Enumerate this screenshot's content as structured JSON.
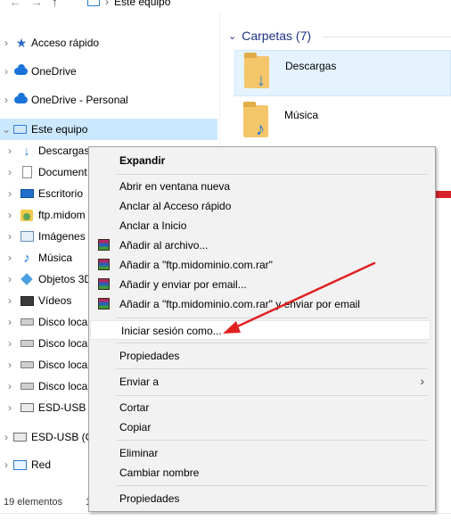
{
  "address": {
    "path": "Este equipo"
  },
  "nav": {
    "back": "←",
    "forward": "→",
    "up": "↑"
  },
  "sidebar": {
    "items": [
      {
        "label": "Acceso rápido"
      },
      {
        "label": "OneDrive"
      },
      {
        "label": "OneDrive - Personal"
      },
      {
        "label": "Este equipo"
      },
      {
        "label": "Descargas"
      },
      {
        "label": "Document"
      },
      {
        "label": "Escritorio"
      },
      {
        "label": "ftp.midom"
      },
      {
        "label": "Imágenes"
      },
      {
        "label": "Música"
      },
      {
        "label": "Objetos 3D"
      },
      {
        "label": "Vídeos"
      },
      {
        "label": "Disco local"
      },
      {
        "label": "Disco local"
      },
      {
        "label": "Disco local"
      },
      {
        "label": "Disco local"
      },
      {
        "label": "ESD-USB ("
      },
      {
        "label": "ESD-USB (G:"
      },
      {
        "label": "Red"
      }
    ],
    "selected_index": 3
  },
  "status": {
    "count": "19 elementos",
    "selection": "1"
  },
  "main": {
    "group_title": "Carpetas (7)",
    "tiles": [
      {
        "label": "Descargas"
      },
      {
        "label": "Música"
      }
    ]
  },
  "context_menu": {
    "items": [
      {
        "label": "Expandir"
      },
      {
        "label": "Abrir en ventana nueva"
      },
      {
        "label": "Anclar al Acceso rápido"
      },
      {
        "label": "Anclar a Inicio"
      },
      {
        "label": "Añadir al archivo..."
      },
      {
        "label": "Añadir a \"ftp.midominio.com.rar\""
      },
      {
        "label": "Añadir y enviar por email..."
      },
      {
        "label": "Añadir a \"ftp.midominio.com.rar\" y enviar por email"
      },
      {
        "label": "Iniciar sesión como..."
      },
      {
        "label": "Propiedades"
      },
      {
        "label": "Enviar a"
      },
      {
        "label": "Cortar"
      },
      {
        "label": "Copiar"
      },
      {
        "label": "Eliminar"
      },
      {
        "label": "Cambiar nombre"
      },
      {
        "label": "Propiedades"
      }
    ],
    "highlighted_index": 8
  },
  "colors": {
    "selection": "#cce8ff",
    "group_header": "#1e3287",
    "annotation_arrow": "#e02020",
    "menu_background": "#f2f2f2"
  }
}
